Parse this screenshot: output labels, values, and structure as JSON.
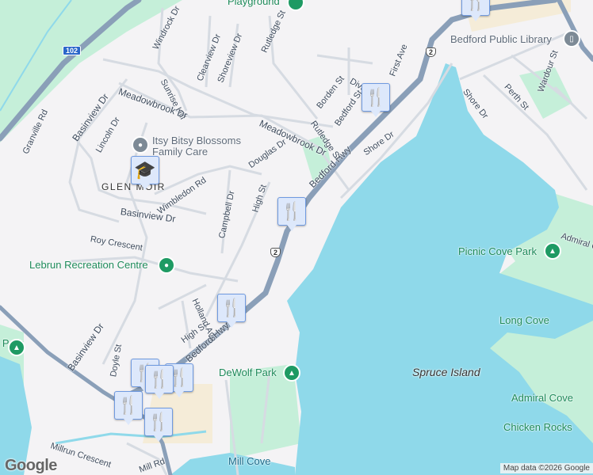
{
  "map": {
    "colors": {
      "land": "#f4f3f5",
      "water": "#8fd9ea",
      "park": "#c5efd9",
      "highway": "#8a9fb8",
      "road": "#d9dde3",
      "commercial": "#f5ecd8"
    },
    "roads": [
      "Windrock Dr",
      "Clearview Dr",
      "Shoreview Dr",
      "Rutledge St",
      "Sunrise Hill",
      "Meadowbrook Dr",
      "Meadowbrook Dr",
      "Basinview Dr",
      "Basinview Dr",
      "Basinview Dr",
      "Lincoln Dr",
      "Granville Rd",
      "Douglas Dr",
      "Wimbledon Rd",
      "Campbell Dr",
      "High St",
      "High St",
      "Roy Crescent",
      "Holland Ave",
      "Bedford Hwy",
      "Bedford Hwy",
      "Borden St",
      "Rutledge St",
      "Bedford St",
      "Divis",
      "First Ave",
      "Shore Dr",
      "Shore Dr",
      "Perth St",
      "Wardour St",
      "Admiral C",
      "Doyle St",
      "Millrun Crescent",
      "Mill Rd"
    ],
    "places": {
      "playground": "Playground",
      "daycare": "Itsy Bitsy Blossoms Family Care",
      "neighborhood": "GLEN MOIR",
      "rec_centre": "Lebrun Recreation Centre",
      "library": "Bedford Public Library",
      "picnic_cove": "Picnic Cove Park",
      "long_cove": "Long Cove",
      "spruce_island": "Spruce Island",
      "admiral_cove": "Admiral Cove",
      "chicken_rocks": "Chicken Rocks",
      "dewolf_park": "DeWolf Park",
      "mill_cove": "Mill Cove",
      "left_park": "e Park"
    },
    "shields": {
      "hwy102": "102",
      "route2a": "2",
      "route2b": "2"
    },
    "markers": {
      "restaurant_icon": "fork-knife",
      "school_icon": "graduation-cap"
    },
    "google_logo": "Google",
    "attribution": "Map data ©2026 Google"
  }
}
